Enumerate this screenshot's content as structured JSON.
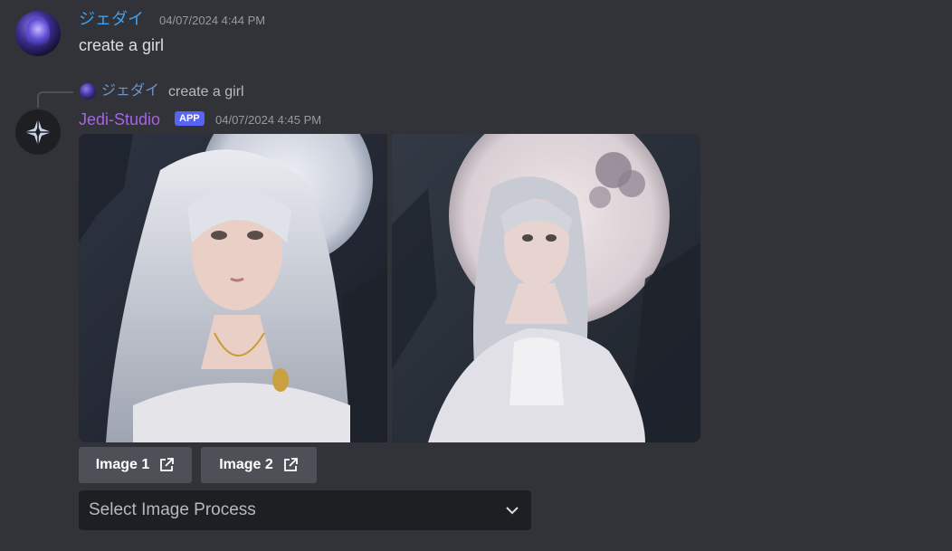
{
  "messages": [
    {
      "author": "ジェダイ",
      "author_color": "#41a0ee",
      "timestamp": "04/07/2024 4:44 PM",
      "content": "create a girl",
      "avatar_icon": "user-avatar"
    },
    {
      "reply": {
        "author": "ジェダイ",
        "content": "create a girl"
      },
      "author": "Jedi-Studio",
      "author_color": "#a664e5",
      "badge": "APP",
      "timestamp": "04/07/2024 4:45 PM",
      "avatar_icon": "diamond-star-icon",
      "attachments": [
        {
          "alt": "image-girl-moon-1"
        },
        {
          "alt": "image-girl-moon-2"
        }
      ],
      "buttons": [
        {
          "label": "Image 1",
          "icon": "external-link-icon"
        },
        {
          "label": "Image 2",
          "icon": "external-link-icon"
        }
      ],
      "select": {
        "placeholder": "Select Image Process",
        "icon": "chevron-down-icon"
      }
    }
  ],
  "colors": {
    "background": "#313338",
    "button": "#4e5058",
    "select_bg": "#1e1f22",
    "badge": "#5865f2"
  }
}
